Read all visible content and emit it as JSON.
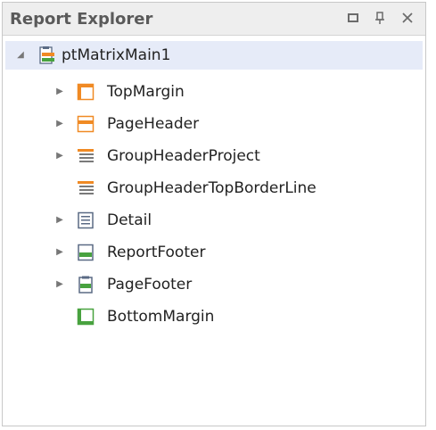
{
  "panel": {
    "title": "Report Explorer",
    "buttons": {
      "maximize": "□",
      "pin": "⊥",
      "close": "✕"
    }
  },
  "tree": {
    "root": {
      "label": "ptMatrixMain1",
      "expanded": true,
      "selected": true
    },
    "children": [
      {
        "label": "TopMargin",
        "icon": "band-top-margin-icon",
        "has_children": true
      },
      {
        "label": "PageHeader",
        "icon": "band-page-header-icon",
        "has_children": true
      },
      {
        "label": "GroupHeaderProject",
        "icon": "band-group-header-icon",
        "has_children": true
      },
      {
        "label": "GroupHeaderTopBorderLine",
        "icon": "band-group-header-icon",
        "has_children": false
      },
      {
        "label": "Detail",
        "icon": "band-detail-icon",
        "has_children": true
      },
      {
        "label": "ReportFooter",
        "icon": "band-report-footer-icon",
        "has_children": true
      },
      {
        "label": "PageFooter",
        "icon": "band-page-footer-icon",
        "has_children": true
      },
      {
        "label": "BottomMargin",
        "icon": "band-bottom-margin-icon",
        "has_children": false
      }
    ]
  },
  "colors": {
    "orange": "#f08a24",
    "green": "#48a23f",
    "blue_gray": "#5a6a84",
    "selection": "#e6ebf8"
  }
}
